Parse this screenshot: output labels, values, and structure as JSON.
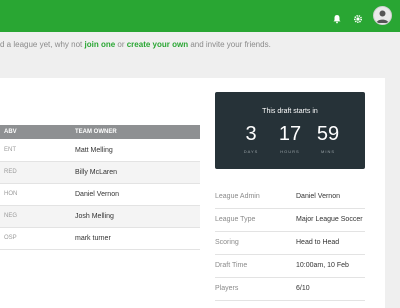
{
  "notice": {
    "prefix": "d a league yet, why not ",
    "join_link": "join one",
    "middle": " or ",
    "create_link": "create your own",
    "suffix": " and invite your friends."
  },
  "topbar": {
    "icons": [
      "bell-icon",
      "gear-icon"
    ],
    "accent": "#29a633"
  },
  "table": {
    "headers": [
      "ABV",
      "TEAM OWNER"
    ],
    "rows": [
      {
        "abv": "ENT",
        "owner": "Matt Melling"
      },
      {
        "abv": "RED",
        "owner": "Billy McLaren"
      },
      {
        "abv": "HON",
        "owner": "Daniel Vernon"
      },
      {
        "abv": "NEG",
        "owner": "Josh Melling"
      },
      {
        "abv": "OSP",
        "owner": "mark turner"
      }
    ]
  },
  "countdown": {
    "title": "This draft starts in",
    "days": "3",
    "days_label": "DAYS",
    "hours": "17",
    "hours_label": "HOURS",
    "mins": "59",
    "mins_label": "MINS"
  },
  "league_info": [
    {
      "label": "League Admin",
      "value": "Daniel Vernon"
    },
    {
      "label": "League Type",
      "value": "Major League Soccer"
    },
    {
      "label": "Scoring",
      "value": "Head to Head"
    },
    {
      "label": "Draft Time",
      "value": "10:00am, 10 Feb"
    },
    {
      "label": "Players",
      "value": "6/10"
    }
  ]
}
